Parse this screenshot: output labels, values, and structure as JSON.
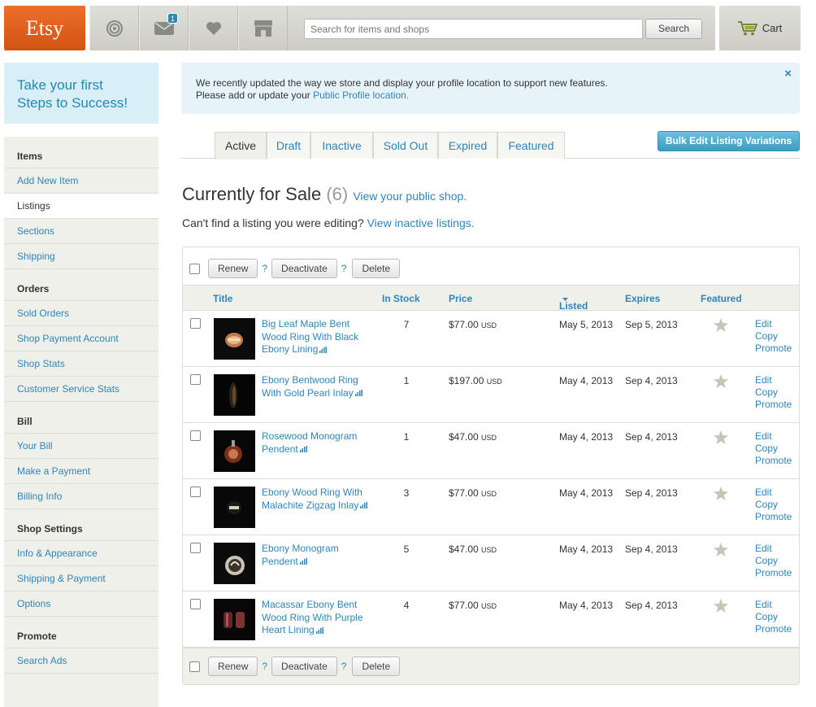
{
  "header": {
    "logo": "Etsy",
    "notification_count": "1",
    "search": {
      "placeholder": "Search for items and shops",
      "button": "Search"
    },
    "cart_label": "Cart",
    "icons": [
      "activity-icon",
      "messages-icon",
      "favorites-icon",
      "shop-icon",
      "cart-icon"
    ]
  },
  "sidebar": {
    "promo": {
      "line1": "Take your first",
      "line2": "Steps to Success!"
    },
    "sections": [
      {
        "heading": "Items",
        "items": [
          "Add New Item",
          "Listings",
          "Sections",
          "Shipping"
        ]
      },
      {
        "heading": "Orders",
        "items": [
          "Sold Orders",
          "Shop Payment Account",
          "Shop Stats",
          "Customer Service Stats"
        ]
      },
      {
        "heading": "Bill",
        "items": [
          "Your Bill",
          "Make a Payment",
          "Billing Info"
        ]
      },
      {
        "heading": "Shop Settings",
        "items": [
          "Info & Appearance",
          "Shipping & Payment",
          "Options"
        ]
      },
      {
        "heading": "Promote",
        "items": [
          "Search Ads"
        ]
      }
    ],
    "active_item": "Listings"
  },
  "notice": {
    "line1": "We recently updated the way we store and display your profile location to support new features.",
    "line2_prefix": "Please add or update your ",
    "line2_link": "Public Profile location.",
    "close": "×"
  },
  "tabs": {
    "items": [
      "Active",
      "Draft",
      "Inactive",
      "Sold Out",
      "Expired",
      "Featured"
    ],
    "active": "Active",
    "bulk_button": "Bulk Edit Listing Variations"
  },
  "main": {
    "title": "Currently for Sale",
    "count": "(6)",
    "view_shop_link": "View your public shop.",
    "subline_prefix": "Can't find a listing you were editing? ",
    "subline_link": "View inactive listings."
  },
  "actions": {
    "renew": "Renew",
    "deactivate": "Deactivate",
    "help": "?",
    "delete": "Delete"
  },
  "table": {
    "columns": {
      "title": "Title",
      "stock": "In Stock",
      "price": "Price",
      "listed": "Listed",
      "expires": "Expires",
      "featured": "Featured"
    },
    "row_actions": [
      "Edit",
      "Copy",
      "Promote"
    ],
    "rows": [
      {
        "title": "Big Leaf Maple Bent Wood Ring With Black Ebony Lining",
        "stock": "7",
        "price": "$77.00",
        "currency": "USD",
        "listed": "May 5, 2013",
        "expires": "Sep 5, 2013",
        "thumb": "ring-wood-light"
      },
      {
        "title": "Ebony Bentwood Ring With Gold Pearl Inlay",
        "stock": "1",
        "price": "$197.00",
        "currency": "USD",
        "listed": "May 4, 2013",
        "expires": "Sep 4, 2013",
        "thumb": "ring-dark-side"
      },
      {
        "title": "Rosewood Monogram Pendent",
        "stock": "1",
        "price": "$47.00",
        "currency": "USD",
        "listed": "May 4, 2013",
        "expires": "Sep 4, 2013",
        "thumb": "pendant-rosewood"
      },
      {
        "title": "Ebony Wood Ring With Malachite Zigzag Inlay",
        "stock": "3",
        "price": "$77.00",
        "currency": "USD",
        "listed": "May 4, 2013",
        "expires": "Sep 4, 2013",
        "thumb": "ring-dark-front"
      },
      {
        "title": "Ebony Monogram Pendent",
        "stock": "5",
        "price": "$47.00",
        "currency": "USD",
        "listed": "May 4, 2013",
        "expires": "Sep 4, 2013",
        "thumb": "pendant-ebony"
      },
      {
        "title": "Macassar Ebony Bent Wood Ring With Purple Heart Lining",
        "stock": "4",
        "price": "$77.00",
        "currency": "USD",
        "listed": "May 4, 2013",
        "expires": "Sep 4, 2013",
        "thumb": "ring-macassar"
      }
    ]
  },
  "colors": {
    "brand_orange": "#d5641c",
    "link_blue": "#2e85b7",
    "panel_beige": "#f0f0ea",
    "notice_blue": "#e6f4fa"
  }
}
